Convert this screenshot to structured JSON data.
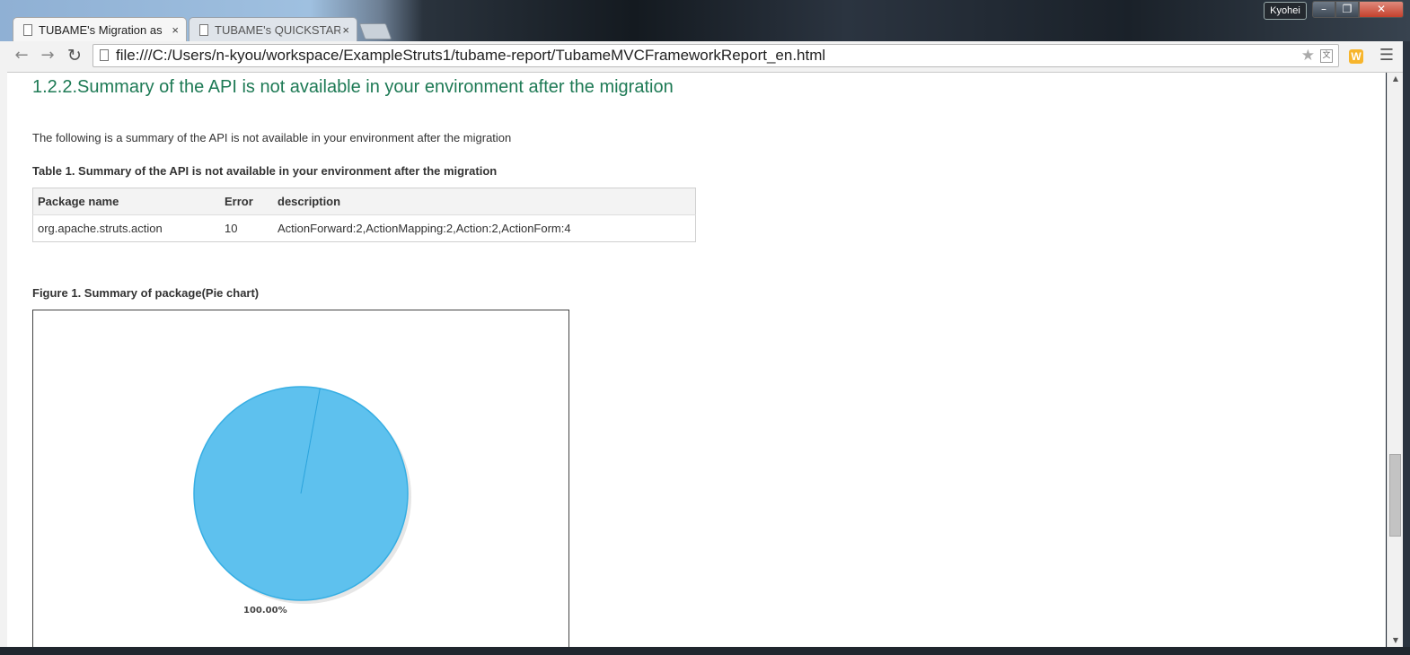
{
  "browser": {
    "tabs": [
      {
        "label": "TUBAME's Migration as",
        "active": true
      },
      {
        "label": "TUBAME's QUICKSTART",
        "active": false
      }
    ],
    "close_glyph": "×",
    "user": "Kyohei",
    "url": "file:///C:/Users/n-kyou/workspace/ExampleStruts1/tubame-report/TubameMVCFrameworkReport_en.html",
    "extension_label": "W",
    "icons": [
      "back-arrow-icon",
      "forward-arrow-icon",
      "reload-icon",
      "page-icon",
      "star-icon",
      "translate-icon",
      "menu-icon"
    ]
  },
  "page": {
    "heading": "1.2.2.Summary of the API is not available in your environment after the migration",
    "intro": "The following is a summary of the API is not available in your environment after the migration",
    "table_caption": "Table 1. Summary of the API is not available in your environment after the migration",
    "table": {
      "headers": [
        "Package name",
        "Error",
        "description"
      ],
      "rows": [
        [
          "org.apache.struts.action",
          "10",
          "ActionForward:2,ActionMapping:2,Action:2,ActionForm:4"
        ]
      ]
    },
    "figure_caption": "Figure 1. Summary of package(Pie chart)"
  },
  "chart_data": {
    "type": "pie",
    "categories": [
      "org.apache.struts.action"
    ],
    "values": [
      100.0
    ],
    "data_labels": [
      "100.00%"
    ],
    "colors": [
      "#5ec1ee"
    ]
  }
}
